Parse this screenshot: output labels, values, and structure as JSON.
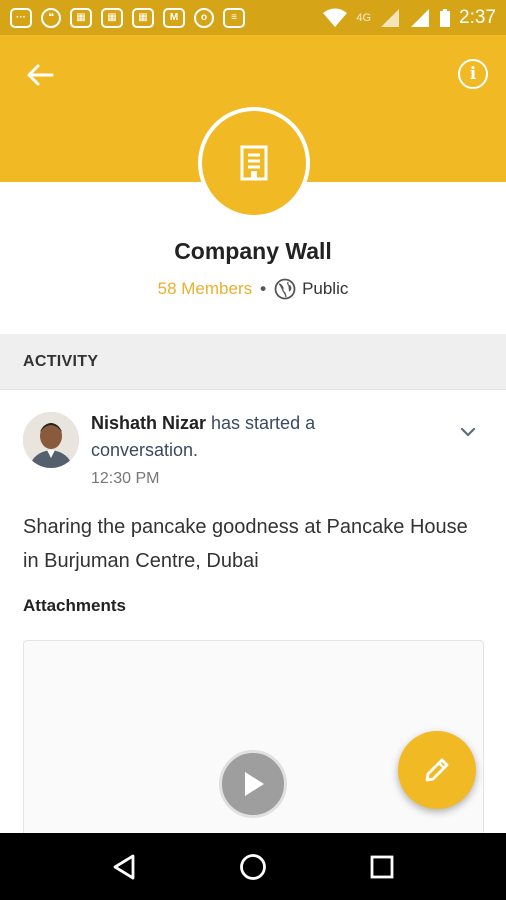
{
  "status_bar": {
    "time": "2:37",
    "network": "4G",
    "notification_icons": [
      "chat-icon",
      "hangouts-icon",
      "calendar-icon",
      "calendar-icon",
      "calendar-icon",
      "gmail-icon",
      "olx-icon",
      "storage-icon"
    ]
  },
  "header": {
    "back_icon": "arrow-left-icon",
    "info_icon": "info-icon",
    "group_icon": "building-icon"
  },
  "group": {
    "title": "Company Wall",
    "members": "58 Members",
    "separator": "•",
    "visibility": "Public"
  },
  "activity": {
    "section_label": "ACTIVITY"
  },
  "post": {
    "author": "Nishath Nizar",
    "action": " has started a conversation.",
    "time": "12:30 PM",
    "text": "Sharing the pancake goodness at Pancake House in Burjuman Centre, Dubai",
    "attachments_label": "Attachments"
  },
  "colors": {
    "primary": "#f1b923",
    "status_bar": "#d6a517",
    "members_text": "#e8b02b"
  },
  "fab_icon": "pencil-icon",
  "nav": [
    "back-triangle-icon",
    "home-circle-icon",
    "recents-square-icon"
  ]
}
